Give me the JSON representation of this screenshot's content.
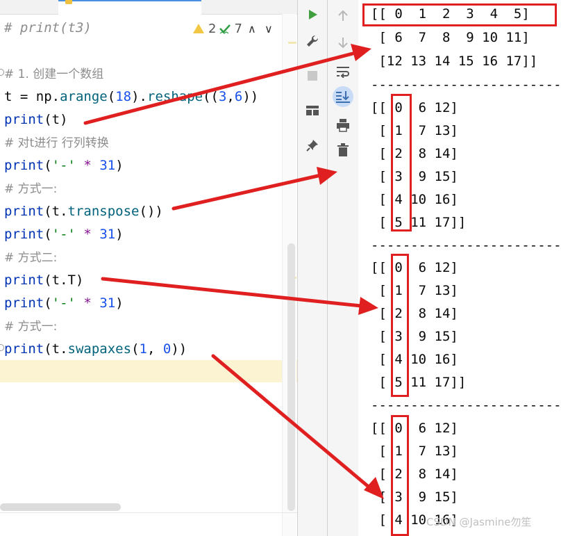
{
  "editor": {
    "inspection": {
      "warnings": "2",
      "weak_warnings": "7"
    },
    "lines": {
      "l0": {
        "comment": "# print(t3)"
      },
      "l1": {
        "comment": "# 1. 创建一个数组"
      },
      "l2": {
        "var": "t",
        "eq": " = ",
        "mod": "np.",
        "m1": "arange",
        "a1": "18",
        "dot": ".",
        "m2": "reshape",
        "open": "((",
        "a2": "3",
        "comma": ",",
        "a3": "6",
        "close": "))"
      },
      "l3": {
        "fn": "print",
        "open": "(",
        "arg": "t",
        "close": ")"
      },
      "l4": {
        "comment": "# 对t进行 行列转换"
      },
      "l5": {
        "fn": "print",
        "open": "(",
        "str": "'-'",
        "op": " * ",
        "num": "31",
        "close": ")"
      },
      "l6": {
        "comment": "# 方式一:"
      },
      "l7": {
        "fn": "print",
        "open": "(",
        "arg": "t.",
        "meth": "transpose",
        "close": "())"
      },
      "l8": {
        "fn": "print",
        "open": "(",
        "str": "'-'",
        "op": " * ",
        "num": "31",
        "close": ")"
      },
      "l9": {
        "comment": "# 方式二:"
      },
      "l10": {
        "fn": "print",
        "open": "(",
        "arg": "t.T",
        "close": ")"
      },
      "l11": {
        "fn": "print",
        "open": "(",
        "str": "'-'",
        "op": " * ",
        "num": "31",
        "close": ")"
      },
      "l12": {
        "comment": "# 方式一:"
      },
      "l13": {
        "fn": "print",
        "open": "(",
        "arg": "t.",
        "meth": "swapaxes",
        "pre": "(",
        "n1": "1",
        "sep": ", ",
        "n2": "0",
        "close": "))"
      }
    }
  },
  "toolbar_icons": [
    "run-icon",
    "wrench-icon",
    "stop-icon",
    "layout-icon",
    "pin-icon",
    "up-arrow-icon",
    "down-arrow-icon",
    "soft-wrap-icon",
    "scroll-to-end-icon",
    "print-icon",
    "trash-icon"
  ],
  "console": {
    "lines": [
      "[[ 0  1  2  3  4  5]",
      " [ 6  7  8  9 10 11]",
      " [12 13 14 15 16 17]]",
      "-------------------------------",
      "[[ 0  6 12]",
      " [ 1  7 13]",
      " [ 2  8 14]",
      " [ 3  9 15]",
      " [ 4 10 16]",
      " [ 5 11 17]]",
      "-------------------------------",
      "[[ 0  6 12]",
      " [ 1  7 13]",
      " [ 2  8 14]",
      " [ 3  9 15]",
      " [ 4 10 16]",
      " [ 5 11 17]]",
      "-------------------------------",
      "[[ 0  6 12]",
      " [ 1  7 13]",
      " [ 2  8 14]",
      " [ 3  9 15]",
      " [ 4 10 16]"
    ]
  },
  "annotation_color": "#e02020",
  "watermark": "CSDN @Jasmine勿笙"
}
